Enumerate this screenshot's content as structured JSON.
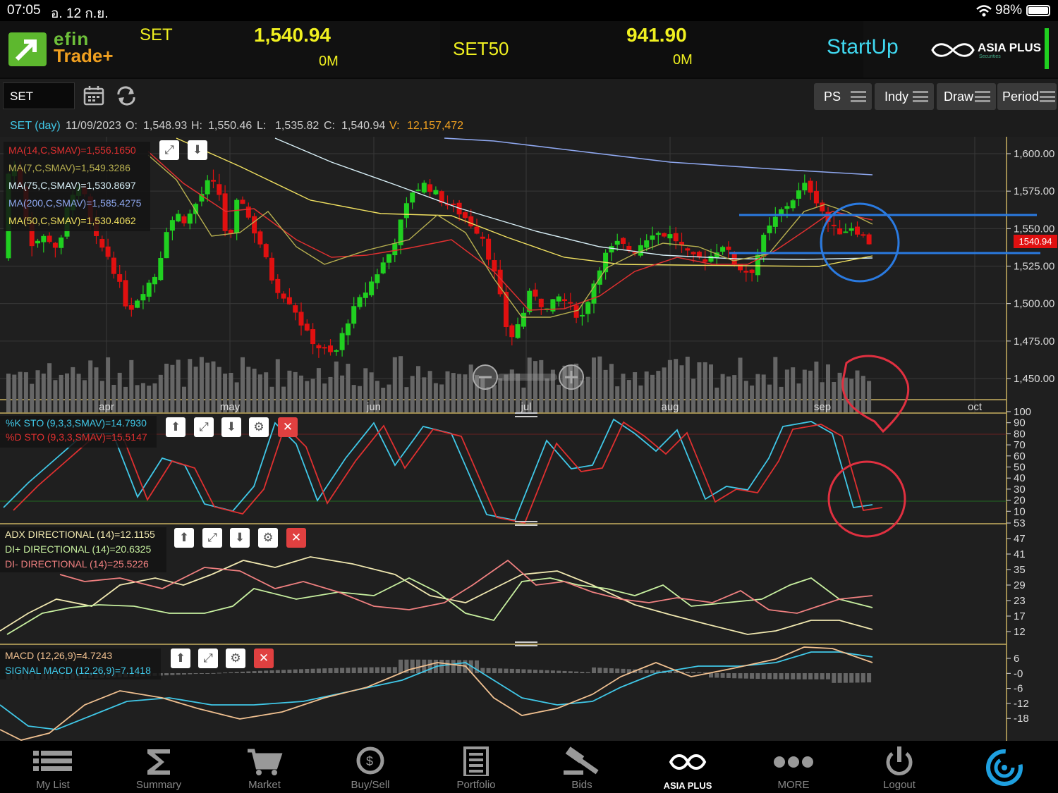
{
  "status": {
    "time": "07:05",
    "date": "อ. 12 ก.ย.",
    "battery": "98%"
  },
  "header": {
    "logo_top": "efin",
    "logo_bottom": "Trade+",
    "index1": {
      "name": "SET",
      "value": "1,540.94",
      "volume": "0M"
    },
    "index2": {
      "name": "SET50",
      "value": "941.90",
      "volume": "0M"
    },
    "startup": "StartUp",
    "broker": "ASIA PLUS",
    "broker_sub": "Securities"
  },
  "toolbar": {
    "symbol": "SET",
    "buttons": [
      "PS",
      "Indy",
      "Draw",
      "Period"
    ]
  },
  "info": {
    "title": "SET (day)",
    "date": "11/09/2023",
    "o_label": "O:",
    "o": "1,548.93",
    "h_label": "H:",
    "h": "1,550.46",
    "l_label": "L:",
    "l": "1,535.82",
    "c_label": "C:",
    "c": "1,540.94",
    "v_label": "V:",
    "v": "12,157,472"
  },
  "legend_price": [
    {
      "text": "MA(14,C,SMAV)=1,556.1650",
      "color": "#e03030"
    },
    {
      "text": "MA(7,C,SMAV)=1,549.3286",
      "color": "#b8b050"
    },
    {
      "text": "MA(75,C,SMAV)=1,530.8697",
      "color": "#d8f0f8"
    },
    {
      "text": "MA(200,C,SMAV)=1,585.4275",
      "color": "#8fa8f0"
    },
    {
      "text": "MA(50,C,SMAV)=1,530.4062",
      "color": "#f0e060"
    }
  ],
  "legend_sto": [
    {
      "text": "%K STO (9,3,3,SMAV)=14.7930",
      "color": "#40c8e8"
    },
    {
      "text": "%D STO (9,3,3,SMAV)=15.5147",
      "color": "#e03030"
    }
  ],
  "legend_adx": [
    {
      "text": "ADX DIRECTIONAL (14)=12.1155",
      "color": "#f0e8b0"
    },
    {
      "text": "DI+ DIRECTIONAL (14)=20.6325",
      "color": "#c8f0a0"
    },
    {
      "text": "DI- DIRECTIONAL (14)=25.5226",
      "color": "#f08080"
    }
  ],
  "legend_macd": [
    {
      "text": "MACD (12,26,9)=4.7243",
      "color": "#f0c090"
    },
    {
      "text": "SIGNAL MACD (12,26,9)=7.1418",
      "color": "#40c8e8"
    }
  ],
  "price_axis": [
    "1,600.00",
    "1,575.00",
    "1,550.00",
    "1,525.00",
    "1,500.00",
    "1,475.00",
    "1,450.00"
  ],
  "price_tag": "1540.94",
  "months": [
    "apr",
    "may",
    "jun",
    "jul",
    "aug",
    "sep",
    "oct"
  ],
  "sto_axis": [
    "100",
    "90",
    "80",
    "70",
    "60",
    "50",
    "40",
    "30",
    "20",
    "10"
  ],
  "adx_axis": [
    "53",
    "47",
    "41",
    "35",
    "29",
    "23",
    "17",
    "12"
  ],
  "macd_axis": [
    "6",
    "-0",
    "-6",
    "-12",
    "-18"
  ],
  "nav": [
    "My List",
    "Summary",
    "Market",
    "Buy/Sell",
    "Portfolio",
    "Bids",
    "ASIA PLUS",
    "MORE",
    "Logout"
  ],
  "colors": {
    "up": "#20d020",
    "down": "#e01010",
    "accent": "#f0f020",
    "startup": "#40d8f0",
    "annotation_blue": "#2a7ae0",
    "annotation_red": "#e03040"
  }
}
